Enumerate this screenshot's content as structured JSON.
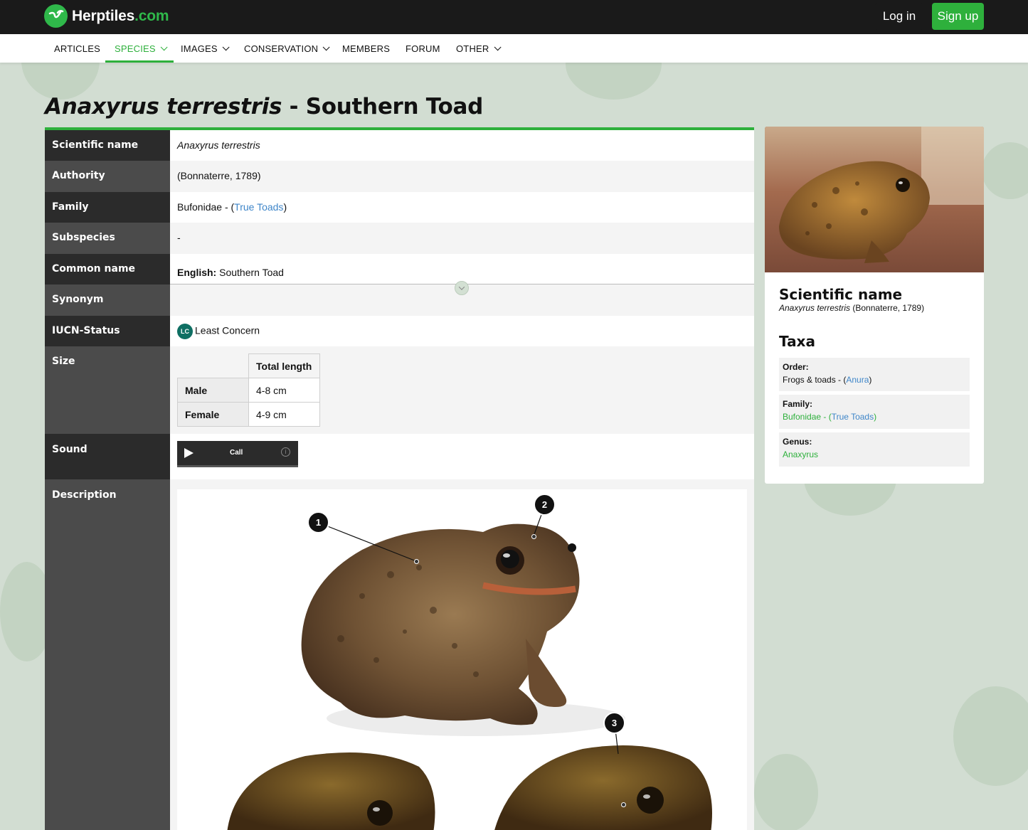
{
  "header": {
    "logo_text": "Herptiles",
    "logo_suffix": ".com",
    "login_label": "Log in",
    "signup_label": "Sign up"
  },
  "nav": {
    "items": [
      {
        "label": "ARTICLES"
      },
      {
        "label": "SPECIES"
      },
      {
        "label": "IMAGES"
      },
      {
        "label": "CONSERVATION"
      },
      {
        "label": "MEMBERS"
      },
      {
        "label": "FORUM"
      },
      {
        "label": "OTHER"
      }
    ]
  },
  "title": {
    "scientific": "Anaxyrus terrestris",
    "separator": " - ",
    "common": "Southern Toad"
  },
  "info": {
    "scientific_name_label": "Scientific name",
    "scientific_name": "Anaxyrus terrestris",
    "authority_label": "Authority",
    "authority": "(Bonnaterre, 1789)",
    "family_label": "Family",
    "family": "Bufonidae - (",
    "family_common": "True Toads",
    "family_close": ")",
    "subspecies_label": "Subspecies",
    "subspecies": "-",
    "common_name_label": "Common name",
    "common_lang": "English:",
    "common_name": "Southern Toad",
    "synonym_label": "Synonym",
    "iucn_label": "IUCN-Status",
    "iucn_code": "LC",
    "iucn_status": "Least Concern",
    "size_label": "Size",
    "size_header": "Total length",
    "size_rows": [
      {
        "sex": "Male",
        "length": "4-8 cm"
      },
      {
        "sex": "Female",
        "length": "4-9 cm"
      }
    ],
    "sound_label": "Sound",
    "sound_name": "Call",
    "sound_info": "i",
    "description_label": "Description",
    "markers": [
      "1",
      "2",
      "3"
    ]
  },
  "sidebar": {
    "scientific_name_heading": "Scientific name",
    "scientific_name": "Anaxyrus terrestris",
    "authority": "(Bonnaterre, 1789)",
    "taxa_heading": "Taxa",
    "order_label": "Order:",
    "order_value": "Frogs & toads - (",
    "order_link": "Anura",
    "family_label": "Family:",
    "family_value": "Bufonidae - (",
    "family_link": "True Toads",
    "genus_label": "Genus:",
    "genus_value": "Anaxyrus",
    "close_paren": ")"
  },
  "colors": {
    "accent": "#2eb03c",
    "link": "#3f86c9",
    "header_bg": "#1a1a1a",
    "page_bg": "#d2ddd2",
    "iucn_lc": "#0f6f63"
  }
}
